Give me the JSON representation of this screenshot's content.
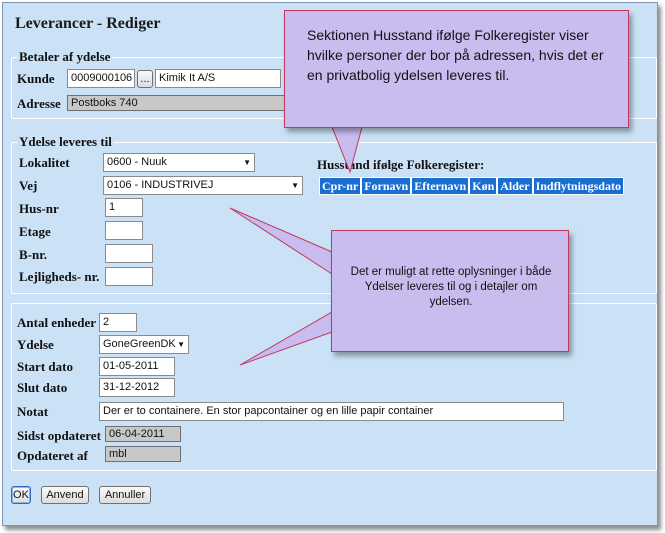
{
  "window": {
    "title": "Leverancer - Rediger"
  },
  "betaler": {
    "legend": "Betaler af ydelse",
    "kunde_label": "Kunde",
    "kunde_nr": "0009000106",
    "browse_label": "...",
    "kunde_navn": "Kimik It A/S",
    "adresse_label": "Adresse",
    "adresse": "Postboks 740"
  },
  "leveres": {
    "legend": "Ydelse leveres til",
    "lokalitet_label": "Lokalitet",
    "lokalitet_value": "0600 - Nuuk",
    "vej_label": "Vej",
    "vej_value": "0106 - INDUSTRIVEJ",
    "husnr_label": "Hus-nr",
    "husnr_value": "1",
    "etage_label": "Etage",
    "etage_value": "",
    "bnr_label": "B-nr.",
    "bnr_value": "",
    "lejl_label": "Lejligheds- nr.",
    "lejl_value": ""
  },
  "husstand": {
    "title": "Husstand ifølge Folkeregister:",
    "columns": [
      "Cpr-nr",
      "Fornavn",
      "Efternavn",
      "Køn",
      "Alder",
      "Indflytningsdato"
    ]
  },
  "detaljer": {
    "antal_label": "Antal enheder",
    "antal_value": "2",
    "ydelse_label": "Ydelse",
    "ydelse_value": "GoneGreenDK",
    "start_label": "Start dato",
    "start_value": "01-05-2011",
    "slut_label": "Slut dato",
    "slut_value": "31-12-2012",
    "notat_label": "Notat",
    "notat_value": "Der er to containere. En stor papcontainer og en lille papir container",
    "sidst_label": "Sidst opdateret",
    "sidst_value": "06-04-2011",
    "opdateret_af_label": "Opdateret af",
    "opdateret_af_value": "mbl"
  },
  "buttons": {
    "ok": "OK",
    "anvend": "Anvend",
    "annuller": "Annuller"
  },
  "callouts": {
    "top": "Sektionen Husstand ifølge Folkeregister viser hvilke personer der bor på adressen, hvis det er en privatbolig ydelsen leveres til.",
    "middle": "Det er muligt at rette oplysninger i både Ydelser leveres til og i detajler om ydelsen."
  },
  "colors": {
    "window_bg": "#cbe1f6",
    "table_header": "#1b6ed1",
    "callout_bg": "#c9bdf0",
    "callout_border": "#c0395e"
  }
}
